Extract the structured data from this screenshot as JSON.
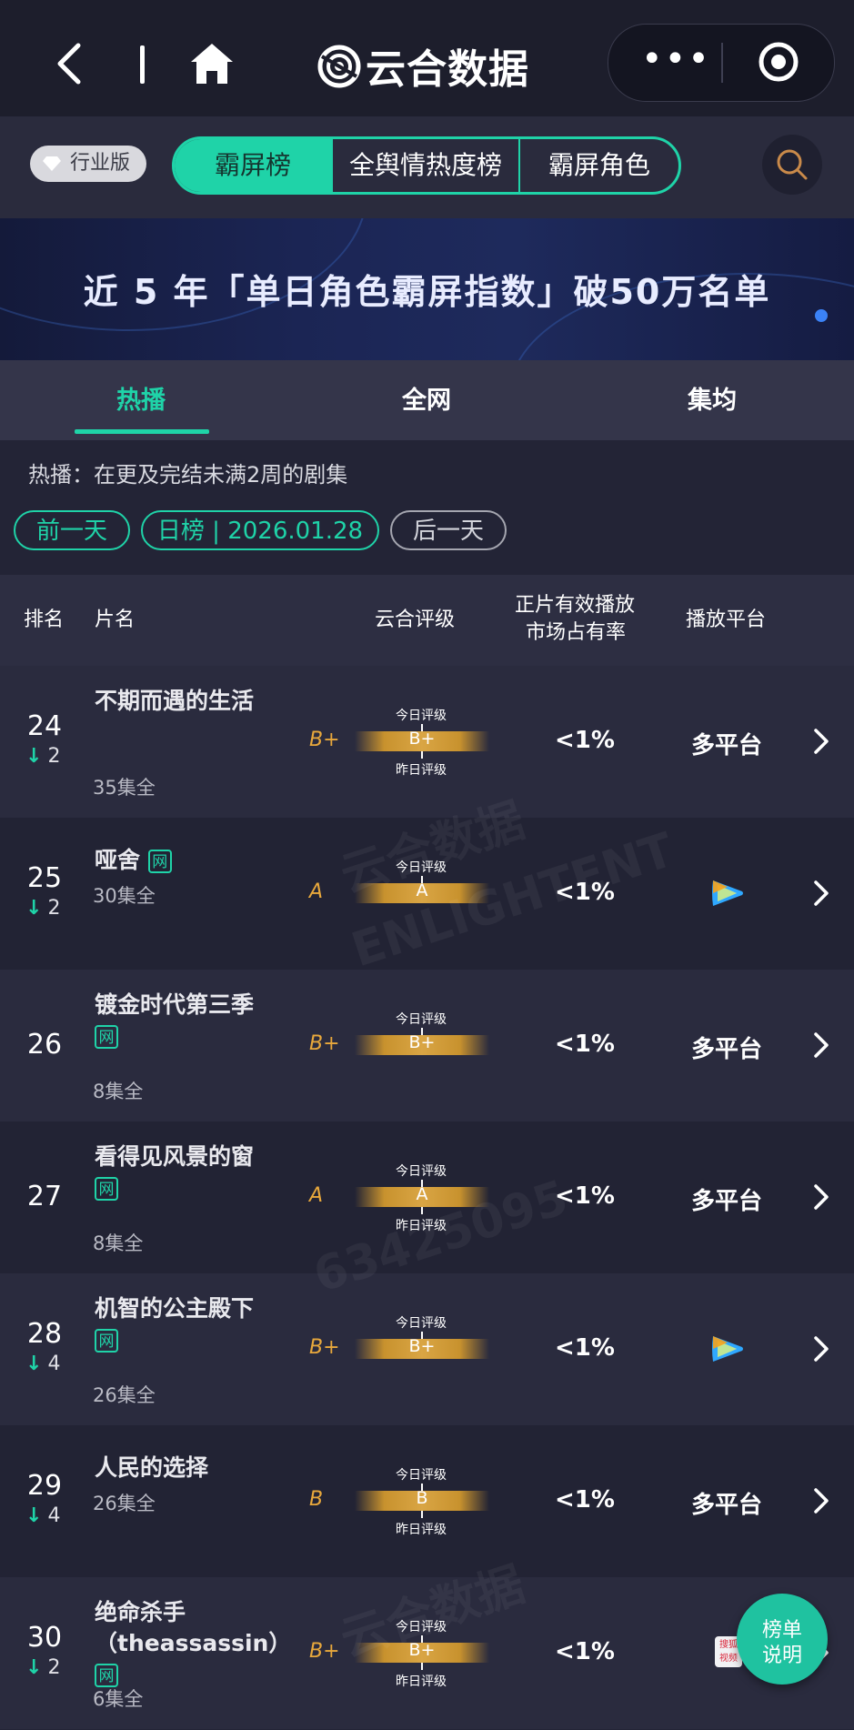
{
  "app": {
    "title": "云合数据",
    "capsule_dots": "•••"
  },
  "filter": {
    "industry_badge": "行业版",
    "tabs": [
      "霸屏榜",
      "全舆情热度榜",
      "霸屏角色"
    ]
  },
  "banner": {
    "text": "近 5 年「单日角色霸屏指数」破50万名单"
  },
  "subtabs": [
    "热播",
    "全网",
    "集均"
  ],
  "description": "热播：在更及完结未满2周的剧集",
  "date_nav": {
    "prev": "前一天",
    "current": "日榜 | 2026.01.28",
    "next": "后一天"
  },
  "table": {
    "headers": {
      "rank": "排名",
      "title": "片名",
      "rating": "云合评级",
      "share_line1": "正片有效播放",
      "share_line2": "市场占有率",
      "platform": "播放平台"
    },
    "today_label": "今日评级",
    "yesterday_label": "昨日评级",
    "rows": [
      {
        "rank": "24",
        "change": "2",
        "title": "不期而遇的生活",
        "net": false,
        "episodes": "35集全",
        "grade": "B+",
        "today": "B+",
        "show_yesterday": true,
        "share": "<1%",
        "platform": "多平台",
        "platform_icon": ""
      },
      {
        "rank": "25",
        "change": "2",
        "title": "哑舍",
        "net": true,
        "episodes": "30集全",
        "grade": "A",
        "today": "A",
        "show_yesterday": false,
        "share": "<1%",
        "platform": "",
        "platform_icon": "tencent-video-icon"
      },
      {
        "rank": "26",
        "change": "",
        "title": "镀金时代第三季",
        "net": true,
        "episodes": "8集全",
        "grade": "B+",
        "today": "B+",
        "show_yesterday": false,
        "share": "<1%",
        "platform": "多平台",
        "platform_icon": ""
      },
      {
        "rank": "27",
        "change": "",
        "title": "看得见风景的窗",
        "net": true,
        "episodes": "8集全",
        "grade": "A",
        "today": "A",
        "show_yesterday": true,
        "share": "<1%",
        "platform": "多平台",
        "platform_icon": ""
      },
      {
        "rank": "28",
        "change": "4",
        "title": "机智的公主殿下",
        "net": true,
        "episodes": "26集全",
        "grade": "B+",
        "today": "B+",
        "show_yesterday": false,
        "share": "<1%",
        "platform": "",
        "platform_icon": "tencent-video-icon"
      },
      {
        "rank": "29",
        "change": "4",
        "title": "人民的选择",
        "net": false,
        "episodes": "26集全",
        "grade": "B",
        "today": "B",
        "show_yesterday": true,
        "share": "<1%",
        "platform": "多平台",
        "platform_icon": ""
      },
      {
        "rank": "30",
        "change": "2",
        "title": "绝命杀手（theassassin）",
        "net": true,
        "episodes": "6集全",
        "grade": "B+",
        "today": "B+",
        "show_yesterday": true,
        "share": "<1%",
        "platform": "",
        "platform_icon": "sohu-video-icon"
      }
    ]
  },
  "float_button": {
    "line1": "榜单",
    "line2": "说明"
  },
  "platform_icon_labels": {
    "sohu": "搜狐\n视频"
  },
  "watermarks": [
    "云合数据",
    "ENLIGHTENT",
    "63425095"
  ],
  "colors": {
    "accent": "#1fd3a8",
    "grade": "#e8a83c"
  }
}
